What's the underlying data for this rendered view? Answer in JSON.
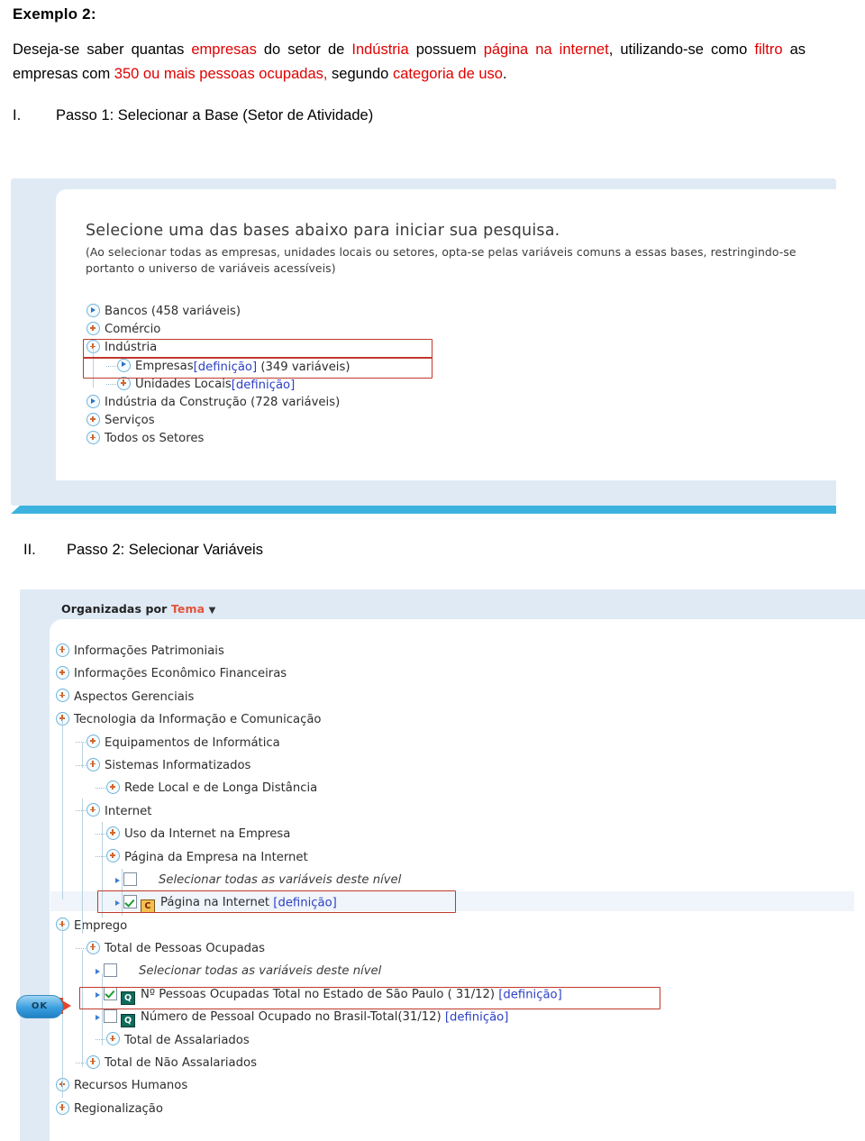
{
  "document": {
    "title": "Exemplo 2:",
    "paragraph": {
      "seg1": "Deseja-se saber quantas ",
      "hl1": "empresas",
      "seg2": " do setor de ",
      "hl2": "Indústria",
      "seg3": " possuem ",
      "hl3": "página na internet",
      "seg4": ", utilizando-se como ",
      "hl4": "filtro",
      "seg5": " as empresas com ",
      "hl5": "350 ou mais pessoas ocupadas,",
      "seg6": " segundo ",
      "hl6": "categoria de uso",
      "seg7": "."
    },
    "steps": [
      {
        "num": "I.",
        "text": "Passo 1: Selecionar a Base (Setor de Atividade)"
      },
      {
        "num": "II.",
        "text": "Passo 2: Selecionar Variáveis"
      }
    ]
  },
  "panel1": {
    "prompt_title": "Selecione uma das bases abaixo para iniciar sua pesquisa.",
    "prompt_sub": "(Ao selecionar todas as empresas, unidades locais ou setores, opta-se pelas variáveis comuns a essas bases, restringindo-se portanto o universo de variáveis acessíveis)",
    "tree": [
      {
        "icon": "arrow-icon",
        "label": "Bancos (458 variáveis)",
        "indent": 0,
        "stub": false
      },
      {
        "icon": "plus-icon",
        "label": "Comércio",
        "indent": 0,
        "stub": false
      },
      {
        "icon": "plus-icon",
        "label": "Indústria",
        "indent": 0,
        "stub": false,
        "highlight": true
      },
      {
        "icon": "arrow-icon",
        "label": "Empresas",
        "suffix_def": "[definição]",
        "suffix_after": " (349 variáveis)",
        "indent": 1,
        "stub": true,
        "highlight": true
      },
      {
        "icon": "plus-icon",
        "label": "Unidades Locais",
        "suffix_def": "[definição]",
        "indent": 1,
        "stub": true
      },
      {
        "icon": "arrow-icon",
        "label": "Indústria da Construção (728 variáveis)",
        "indent": 0,
        "stub": false
      },
      {
        "icon": "plus-icon",
        "label": "Serviços",
        "indent": 0,
        "stub": false
      },
      {
        "icon": "plus-icon",
        "label": "Todos os Setores",
        "indent": 0,
        "stub": false
      }
    ]
  },
  "panel2": {
    "header_prefix": "Organizadas por ",
    "header_value": "Tema",
    "header_caret": "▼",
    "ok_button": "OK",
    "tree": [
      {
        "kind": "node",
        "icon": "plus-icon",
        "label": "Informações Patrimoniais",
        "indent": 0,
        "stub": false
      },
      {
        "kind": "node",
        "icon": "plus-icon",
        "label": "Informações Econômico Financeiras",
        "indent": 0,
        "stub": false
      },
      {
        "kind": "node",
        "icon": "plus-icon",
        "label": "Aspectos Gerenciais",
        "indent": 0,
        "stub": false
      },
      {
        "kind": "node",
        "icon": "plus-icon",
        "label": "Tecnologia da Informação e Comunicação",
        "indent": 0,
        "stub": false
      },
      {
        "kind": "node",
        "icon": "plus-icon",
        "label": "Equipamentos de Informática",
        "indent": 1,
        "stub": true
      },
      {
        "kind": "node",
        "icon": "plus-icon",
        "label": "Sistemas Informatizados",
        "indent": 1,
        "stub": true
      },
      {
        "kind": "node",
        "icon": "plus-icon",
        "label": "Rede Local e de Longa Distância",
        "indent": 2,
        "stub": true
      },
      {
        "kind": "node",
        "icon": "plus-icon",
        "label": "Internet",
        "indent": 1,
        "stub": true
      },
      {
        "kind": "node",
        "icon": "plus-icon",
        "label": "Uso da Internet na Empresa",
        "indent": 2,
        "stub": true
      },
      {
        "kind": "node",
        "icon": "plus-icon",
        "label": "Página da Empresa na Internet",
        "indent": 2,
        "stub": true
      },
      {
        "kind": "leaf",
        "checked": false,
        "badge": null,
        "italic": true,
        "label": "Selecionar todas as variáveis deste nível",
        "indent": 3
      },
      {
        "kind": "leaf",
        "checked": true,
        "badge": "C",
        "italic": false,
        "label": "Página na Internet ",
        "suffix_def": "[definição]",
        "indent": 3,
        "highlight": true,
        "rowfill": true
      },
      {
        "kind": "node",
        "icon": "plus-icon",
        "label": "Emprego",
        "indent": 0,
        "stub": false
      },
      {
        "kind": "node",
        "icon": "plus-icon",
        "label": "Total de Pessoas Ocupadas",
        "indent": 1,
        "stub": true
      },
      {
        "kind": "leaf",
        "checked": false,
        "badge": null,
        "italic": true,
        "label": "Selecionar todas as variáveis deste nível",
        "indent": 2
      },
      {
        "kind": "leaf",
        "checked": true,
        "badge": "Q",
        "italic": false,
        "label": "Nº Pessoas Ocupadas Total no Estado de São Paulo ( 31/12) ",
        "suffix_def": "[definição]",
        "indent": 2,
        "highlight": true
      },
      {
        "kind": "leaf",
        "checked": false,
        "badge": "Q",
        "italic": false,
        "label": "Número de Pessoal Ocupado no Brasil-Total(31/12) ",
        "suffix_def": "[definição]",
        "indent": 2
      },
      {
        "kind": "node",
        "icon": "plus-icon",
        "label": "Total de Assalariados",
        "indent": 2,
        "stub": true
      },
      {
        "kind": "node",
        "icon": "plus-icon",
        "label": "Total de Não Assalariados",
        "indent": 1,
        "stub": true
      },
      {
        "kind": "node",
        "icon": "plus-icon",
        "label": "Recursos Humanos",
        "indent": 0,
        "stub": false
      },
      {
        "kind": "node",
        "icon": "plus-icon",
        "label": "Regionalização",
        "indent": 0,
        "stub": false
      }
    ]
  },
  "colors": {
    "highlight_red": "#e00000",
    "selection_box": "#c0392b",
    "panel_blue": "#dfeaf5",
    "accent_bar": "#3cb3de",
    "link_blue": "#2b3fc4",
    "tema_orange": "#e2543a"
  }
}
